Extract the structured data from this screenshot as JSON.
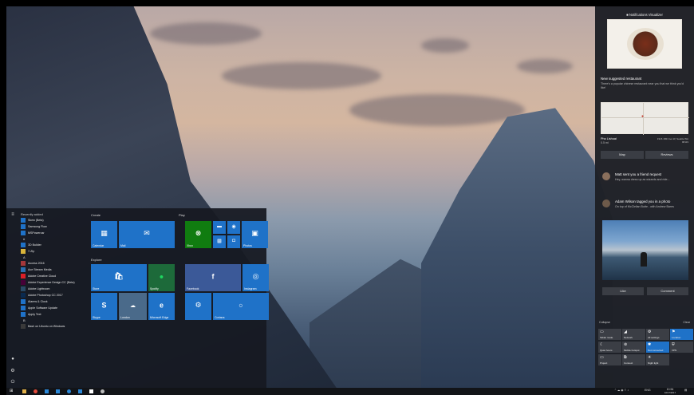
{
  "start_menu": {
    "recently_added_label": "Recently added",
    "recent_apps": [
      {
        "label": "Skew (Beta)",
        "color": "#1f72c8"
      },
      {
        "label": "Samsung Flow",
        "color": "#1f72c8"
      },
      {
        "label": "MSPowerusr",
        "color": "#1f72c8"
      }
    ],
    "letters": [
      "#",
      "A",
      "B"
    ],
    "apps_hash": [
      {
        "label": "3D Builder",
        "color": "#1f72c8"
      },
      {
        "label": "7-Zip",
        "color": "#d9b43a"
      }
    ],
    "apps_a": [
      {
        "label": "Access 2016",
        "color": "#a4373a"
      },
      {
        "label": "Ace Stream Media",
        "color": "#2a6fb0"
      },
      {
        "label": "Adobe Creative Cloud",
        "color": "#da1f26"
      },
      {
        "label": "Adobe Experience Design CC (Beta)",
        "color": "#470137"
      },
      {
        "label": "Adobe Lightroom",
        "color": "#2a4b66"
      },
      {
        "label": "Adobe Photoshop CC 2017",
        "color": "#0a2a4f"
      },
      {
        "label": "Alarms & Clock",
        "color": "#1f72c8"
      },
      {
        "label": "Apple Software Update",
        "color": "#1f72c8"
      },
      {
        "label": "Apply Text",
        "color": "#1f72c8"
      }
    ],
    "apps_b": [
      {
        "label": "Bash on Ubuntu on Windows",
        "color": "#3a3a3a"
      }
    ],
    "groups": {
      "create": "Create",
      "play": "Play",
      "explore": "Explore"
    },
    "tiles": {
      "calendar": {
        "label": "Calendar",
        "glyph": "▦"
      },
      "mail": {
        "label": "Mail",
        "glyph": "✉"
      },
      "xbox": {
        "label": "Xbox",
        "glyph": "⊗"
      },
      "photos": {
        "label": "Photos",
        "glyph": "▣"
      },
      "store": {
        "label": "Store",
        "glyph": "🛍"
      },
      "spotify": {
        "label": "Spotify",
        "glyph": "●"
      },
      "facebook": {
        "label": "Facebook",
        "glyph": "f"
      },
      "instagram": {
        "label": "Instagram",
        "glyph": "◎"
      },
      "skype": {
        "label": "Skype",
        "glyph": "S"
      },
      "weather": {
        "label": "London",
        "glyph": "☁"
      },
      "edge": {
        "label": "Microsoft Edge",
        "glyph": "e"
      },
      "settings": {
        "label": "",
        "glyph": "⚙"
      },
      "cortana": {
        "label": "Cortana",
        "glyph": "○"
      }
    },
    "accent": "#1f72c8",
    "xbox_color": "#107c10"
  },
  "action_center": {
    "title": "Notifications Visualizer",
    "restaurant": {
      "heading": "New suggested restaurant",
      "body": "There's a popular chinese restaurant near you that we think you'd like!",
      "place": "Pho Lishuai",
      "distance": "0.5 mi",
      "address": "1916 18th Ave W, Seattle WA 98119",
      "buttons": [
        "Map",
        "Reviews"
      ]
    },
    "friend_request": {
      "heading": "Matt sent you a friend request",
      "body": "Hey, wanna dress up as wizards and ride..."
    },
    "photo_tag": {
      "heading": "Adam Wilson tagged you in a photo",
      "body": "On top of McClellan Butte - with Andrew Bares",
      "buttons": [
        "Like",
        "Comment"
      ]
    },
    "collapse_label": "Collapse",
    "clear_label": "Clear",
    "quick_actions": [
      {
        "label": "Tablet mode",
        "glyph": "▭",
        "on": false
      },
      {
        "label": "Network",
        "glyph": "◢",
        "on": false
      },
      {
        "label": "All settings",
        "glyph": "⚙",
        "on": false
      },
      {
        "label": "Location",
        "glyph": "⚑",
        "on": true
      },
      {
        "label": "Quiet hours",
        "glyph": "☾",
        "on": false
      },
      {
        "label": "Mobile hotspot",
        "glyph": "⊚",
        "on": false
      },
      {
        "label": "Not connected",
        "glyph": "✱",
        "on": true
      },
      {
        "label": "VPN",
        "glyph": "⛨",
        "on": false
      },
      {
        "label": "Project",
        "glyph": "▭",
        "on": false
      },
      {
        "label": "Connect",
        "glyph": "⧉",
        "on": false
      },
      {
        "label": "Night light",
        "glyph": "☀",
        "on": false
      }
    ]
  },
  "taskbar": {
    "clock_time": "10:54",
    "clock_date": "10/17/2017",
    "language": "ENG",
    "icons": [
      "windows-logo",
      "file-explorer",
      "chrome",
      "store",
      "mail",
      "skype",
      "edge",
      "groove",
      "settings"
    ]
  }
}
